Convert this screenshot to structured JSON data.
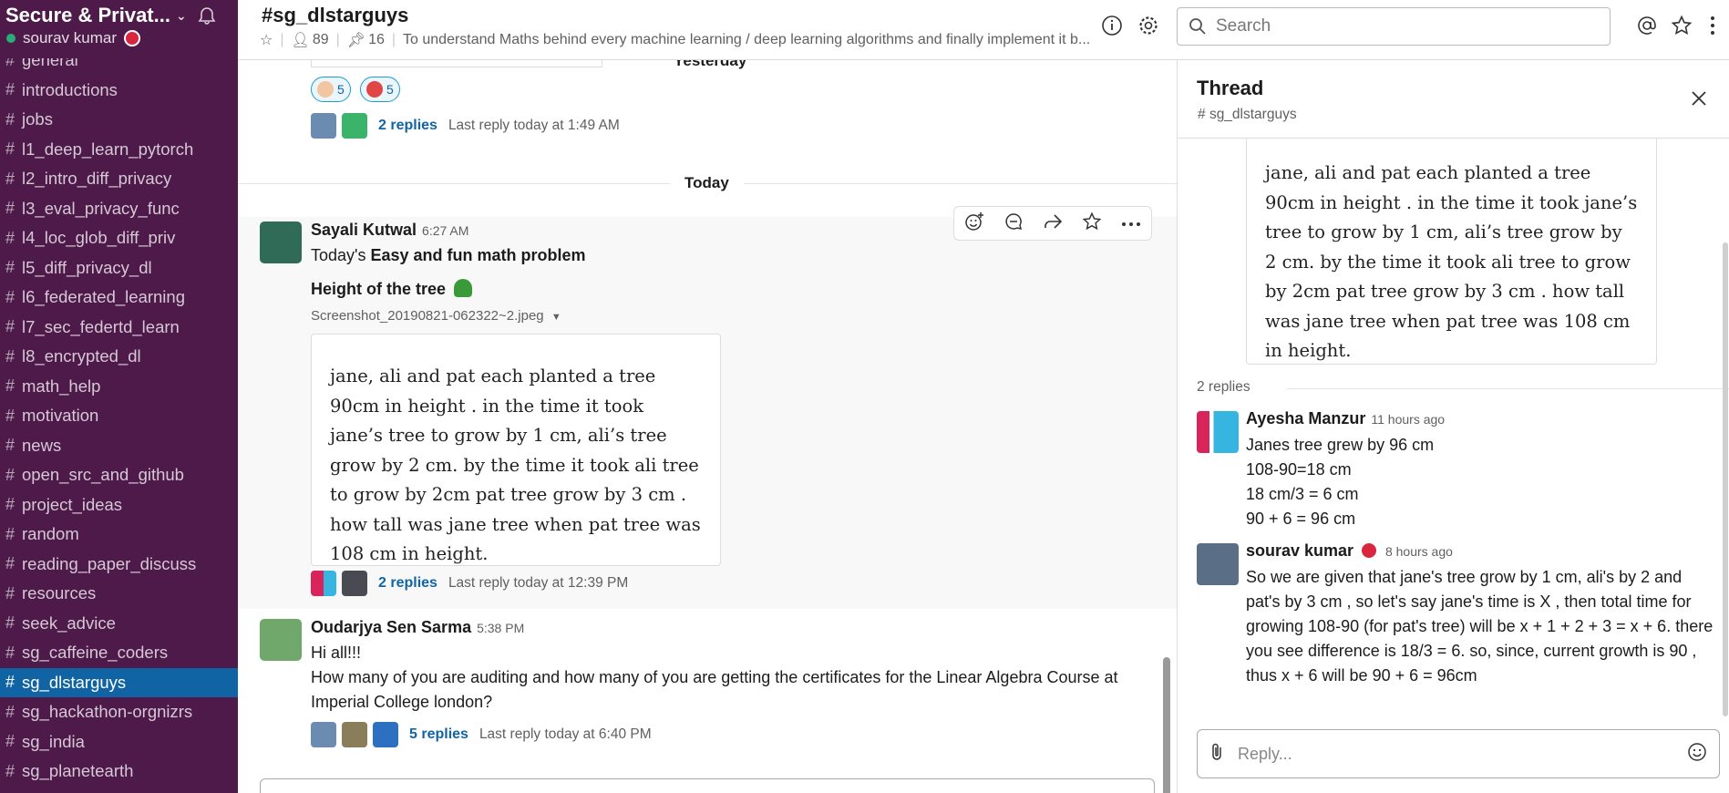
{
  "workspace": {
    "name": "Secure & Privat...",
    "user": "sourav kumar"
  },
  "sidebar": {
    "channels": [
      {
        "label": "general",
        "active": false
      },
      {
        "label": "introductions",
        "active": false
      },
      {
        "label": "jobs",
        "active": false
      },
      {
        "label": "l1_deep_learn_pytorch",
        "active": false
      },
      {
        "label": "l2_intro_diff_privacy",
        "active": false
      },
      {
        "label": "l3_eval_privacy_func",
        "active": false
      },
      {
        "label": "l4_loc_glob_diff_priv",
        "active": false
      },
      {
        "label": "l5_diff_privacy_dl",
        "active": false
      },
      {
        "label": "l6_federated_learning",
        "active": false
      },
      {
        "label": "l7_sec_federtd_learn",
        "active": false
      },
      {
        "label": "l8_encrypted_dl",
        "active": false
      },
      {
        "label": "math_help",
        "active": false
      },
      {
        "label": "motivation",
        "active": false
      },
      {
        "label": "news",
        "active": false
      },
      {
        "label": "open_src_and_github",
        "active": false
      },
      {
        "label": "project_ideas",
        "active": false
      },
      {
        "label": "random",
        "active": false
      },
      {
        "label": "reading_paper_discuss",
        "active": false
      },
      {
        "label": "resources",
        "active": false
      },
      {
        "label": "seek_advice",
        "active": false
      },
      {
        "label": "sg_caffeine_coders",
        "active": false
      },
      {
        "label": "sg_dlstarguys",
        "active": true
      },
      {
        "label": "sg_hackathon-orgnizrs",
        "active": false
      },
      {
        "label": "sg_india",
        "active": false
      },
      {
        "label": "sg_planetearth",
        "active": false
      }
    ]
  },
  "header": {
    "channel": "#sg_dlstarguys",
    "members": "89",
    "pins": "16",
    "topic": "To understand Maths behind every machine learning / deep learning algorithms and finally implement it b..."
  },
  "search": {
    "placeholder": "Search"
  },
  "messages": {
    "yesterday_label": "Yesterday",
    "today_label": "Today",
    "reaction1_count": "5",
    "reaction2_count": "5",
    "prev_thread": {
      "replies": "2 replies",
      "last": "Last reply today at 1:49 AM"
    },
    "msg1": {
      "author": "Sayali Kutwal",
      "time": "6:27 AM",
      "line1_prefix": "Today's ",
      "line1_bold": "Easy and fun math problem",
      "line2": "Height of the tree",
      "file": "Screenshot_20190821-062322~2.jpeg",
      "image_text": "jane, ali and pat each planted a tree 90cm in height . in the time it took jane’s tree to grow by 1 cm, ali’s tree grow by 2 cm. by the time it took ali tree to grow by 2cm pat tree grow by 3 cm . how tall was jane tree when pat tree was 108 cm in height.",
      "replies": "2 replies",
      "last": "Last reply today at 12:39 PM"
    },
    "msg2": {
      "author": "Oudarjya Sen Sarma",
      "time": "5:38 PM",
      "line1": "Hi all!!!",
      "line2": "How many of you are auditing and how many of you are getting the certificates for the Linear Algebra Course at Imperial College london?",
      "replies": "5 replies",
      "last": "Last reply today at 6:40 PM"
    }
  },
  "thread": {
    "title": "Thread",
    "channel": "sg_dlstarguys",
    "image_text": "jane, ali and pat each planted a tree 90cm in height . in the time it took jane’s tree to grow by 1 cm, ali’s tree grow by 2 cm. by the time it took ali tree to grow by 2cm pat tree grow by 3 cm . how tall was jane tree when pat tree was 108 cm in height.",
    "replies_count": "2 replies",
    "reply1": {
      "author": "Ayesha Manzur",
      "time": "11 hours ago",
      "lines": [
        "Janes tree grew by 96 cm",
        "108-90=18 cm",
        "18 cm/3 = 6 cm",
        "90 + 6 = 96 cm"
      ]
    },
    "reply2": {
      "author": "sourav kumar",
      "time": "8 hours ago",
      "text": "So we are given that jane's tree grow by 1 cm, ali's by 2 and pat's by 3 cm , so let's say jane's time is X , then total time for growing 108-90 (for pat's tree) will be  x + 1 + 2 + 3 = x + 6. there you see difference is 18/3 = 6. so, since, current growth is 90 , thus x + 6 will be 90 + 6 = 96cm"
    },
    "composer_placeholder": "Reply..."
  },
  "colors": {
    "sidebar": "#4d1a4a",
    "active": "#1164a3",
    "link": "#1264a3"
  }
}
